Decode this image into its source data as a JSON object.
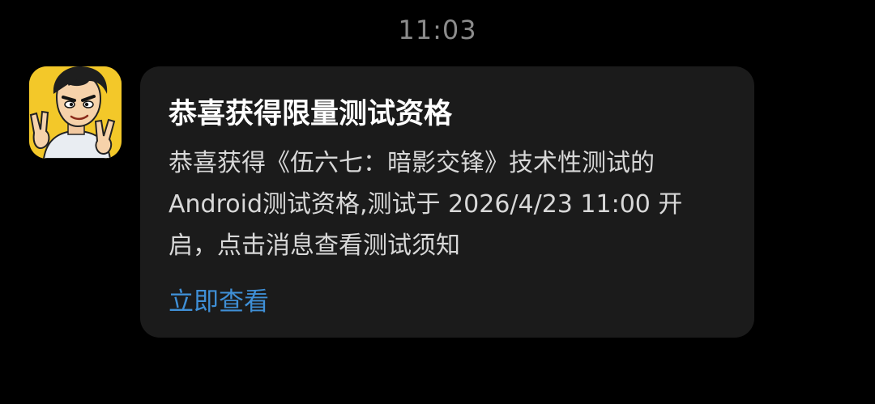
{
  "status": {
    "time": "11:03"
  },
  "message": {
    "avatar_icon": "game-character-avatar-icon",
    "title": "恭喜获得限量测试资格",
    "body": "恭喜获得《伍六七：暗影交锋》技术性测试的Android测试资格,测试于 2026/4/23 11:00 开启，点击消息查看测试须知",
    "action_label": "立即查看"
  },
  "colors": {
    "background": "#000000",
    "card": "#1b1b1b",
    "title": "#ffffff",
    "body": "#d8d8d8",
    "timestamp": "#8c8c8c",
    "link": "#3f8fd6",
    "avatar_bg": "#f3c829"
  }
}
